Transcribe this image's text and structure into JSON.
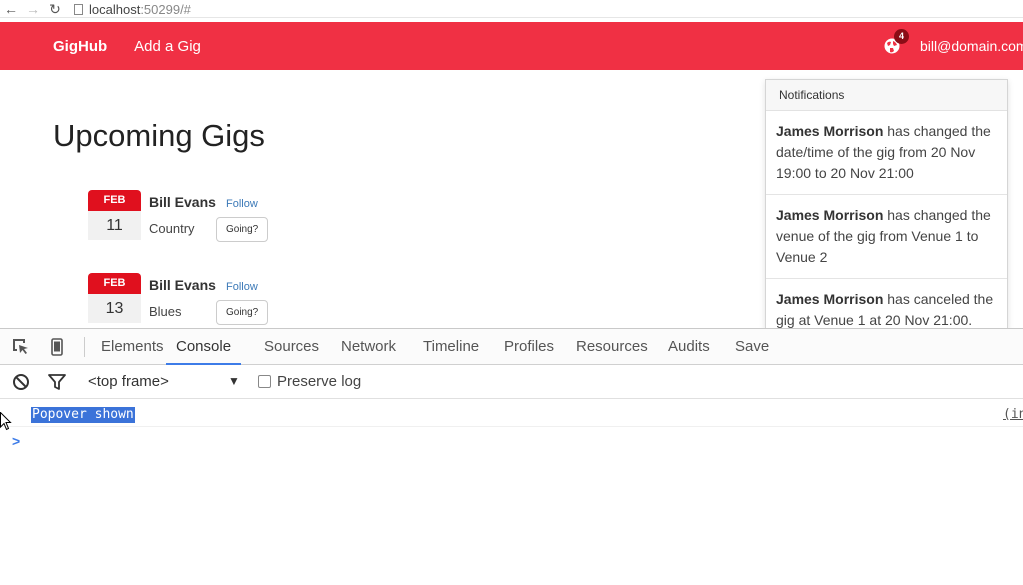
{
  "browser": {
    "url_host": "localhost",
    "url_suffix": ":50299/#"
  },
  "navbar": {
    "brand": "GigHub",
    "add_gig": "Add a Gig",
    "notification_count": "4",
    "user": "bill@domain.com"
  },
  "page": {
    "title": "Upcoming Gigs"
  },
  "gigs": [
    {
      "month": "FEB",
      "day": "11",
      "artist": "Bill Evans",
      "follow": "Follow",
      "genre": "Country",
      "going": "Going?"
    },
    {
      "month": "FEB",
      "day": "13",
      "artist": "Bill Evans",
      "follow": "Follow",
      "genre": "Blues",
      "going": "Going?"
    }
  ],
  "notifications": {
    "title": "Notifications",
    "items": [
      {
        "who": "James Morrison",
        "text": " has changed the date/time of the gig from 20 Nov 19:00 to 20 Nov 21:00"
      },
      {
        "who": "James Morrison",
        "text": " has changed the venue of the gig from Venue 1 to Venue 2"
      },
      {
        "who": "James Morrison",
        "text": " has canceled the gig at Venue 1 at 20 Nov 21:00."
      }
    ]
  },
  "devtools": {
    "tabs": [
      "Elements",
      "Console",
      "Sources",
      "Network",
      "Timeline",
      "Profiles",
      "Resources",
      "Audits",
      "Save"
    ],
    "active_tab": "Console",
    "frame": "<top frame>",
    "preserve_log": "Preserve log",
    "console_message": "Popover shown",
    "console_source": "(index)",
    "prompt": ">"
  },
  "colors": {
    "navbar": "#f03044",
    "date_month": "#e0101e",
    "selection": "#3b73d9"
  }
}
